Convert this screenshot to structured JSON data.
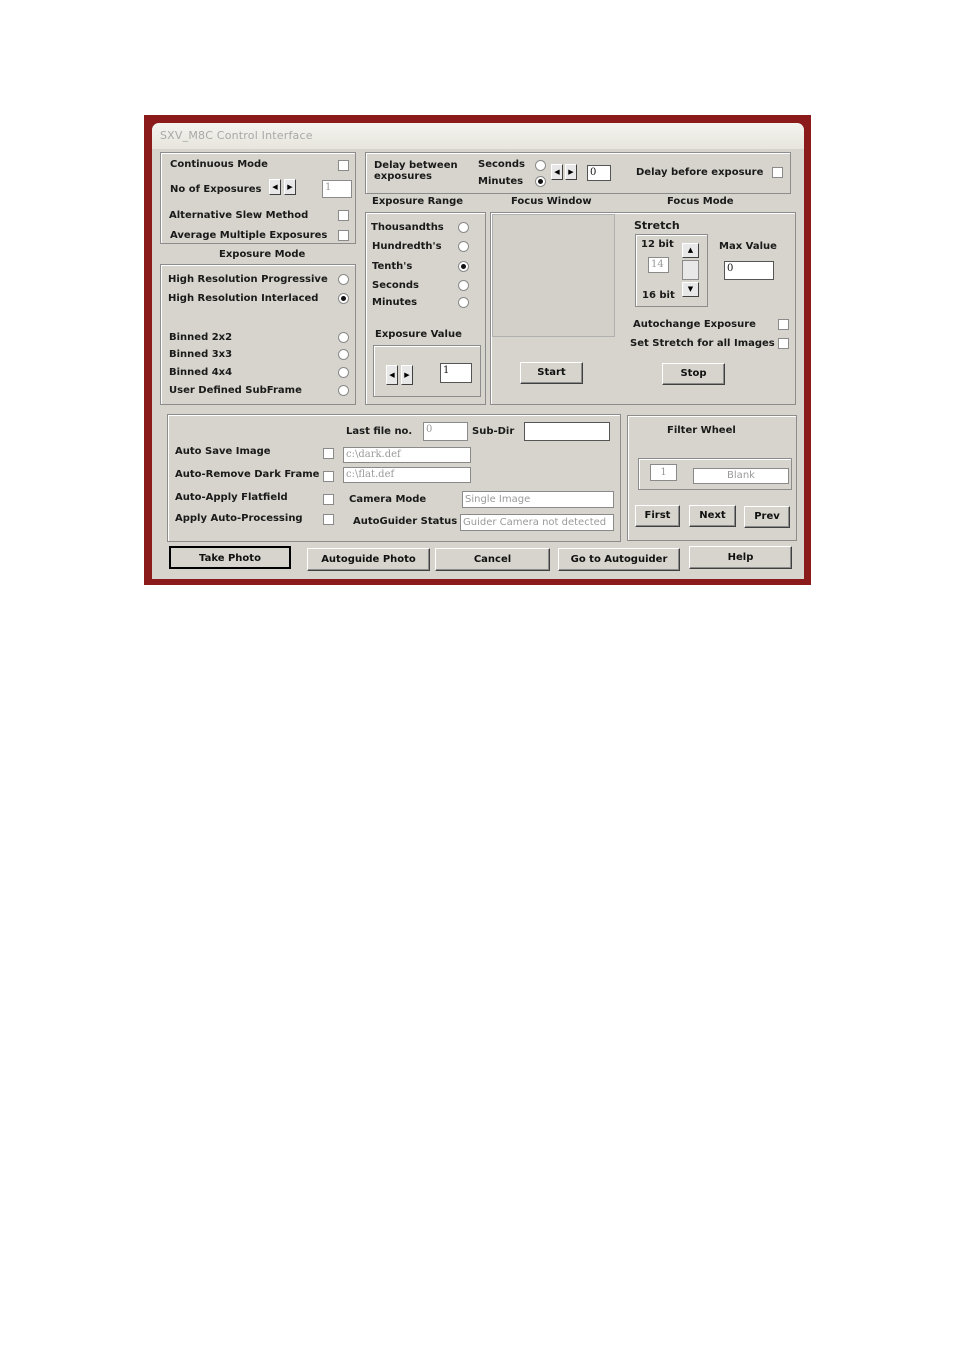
{
  "window": {
    "title": "SXV_M8C Control Interface"
  },
  "left_panel": {
    "continuous_mode": "Continuous Mode",
    "no_of_exposures": "No of Exposures",
    "no_of_exposures_value": "1",
    "alt_slew": "Alternative Slew Method",
    "avg_multiple": "Average Multiple Exposures",
    "exposure_mode_title": "Exposure Mode",
    "modes": [
      {
        "label": "High Resolution Progressive",
        "selected": false
      },
      {
        "label": "High Resolution Interlaced",
        "selected": true
      },
      {
        "label": "Binned 2x2",
        "selected": false
      },
      {
        "label": "Binned 3x3",
        "selected": false
      },
      {
        "label": "Binned 4x4",
        "selected": false
      },
      {
        "label": "User Defined SubFrame",
        "selected": false
      }
    ]
  },
  "delay": {
    "label": "Delay between exposures",
    "seconds": "Seconds",
    "minutes": "Minutes",
    "value": "0",
    "before_label": "Delay before exposure"
  },
  "exposure_range": {
    "title": "Exposure Range",
    "options": [
      {
        "label": "Thousandths",
        "selected": false
      },
      {
        "label": "Hundredth's",
        "selected": false
      },
      {
        "label": "Tenth's",
        "selected": true
      },
      {
        "label": "Seconds",
        "selected": false
      },
      {
        "label": "Minutes",
        "selected": false
      }
    ],
    "value_title": "Exposure Value",
    "value": "1"
  },
  "focus": {
    "window_title": "Focus Window",
    "mode_title": "Focus Mode",
    "stretch": "Stretch",
    "bit12": "12 bit",
    "bit16": "16 bit",
    "stretch_value": "14",
    "max_value_label": "Max Value",
    "max_value": "0",
    "autochange": "Autochange Exposure",
    "set_stretch": "Set Stretch for all Images",
    "start": "Start",
    "stop": "Stop"
  },
  "save": {
    "last_file_label": "Last file no.",
    "last_file_value": "0",
    "subdir_label": "Sub-Dir",
    "subdir_value": "",
    "auto_save": "Auto Save Image",
    "auto_remove_dark": "Auto-Remove Dark Frame",
    "dark_path": "c:\\dark.def",
    "auto_flat": "Auto-Apply Flatfield",
    "flat_path": "c:\\flat.def",
    "auto_processing": "Apply Auto-Processing",
    "camera_mode_label": "Camera Mode",
    "camera_mode_value": "Single Image",
    "autoguider_label": "AutoGuider Status",
    "autoguider_value": "Guider Camera not detected"
  },
  "filter": {
    "title": "Filter Wheel",
    "position": "1",
    "name": "Blank",
    "first": "First",
    "next": "Next",
    "prev": "Prev"
  },
  "footer": {
    "take_photo": "Take Photo",
    "autoguide_photo": "Autoguide Photo",
    "cancel": "Cancel",
    "goto_autoguider": "Go to Autoguider",
    "help": "Help"
  }
}
